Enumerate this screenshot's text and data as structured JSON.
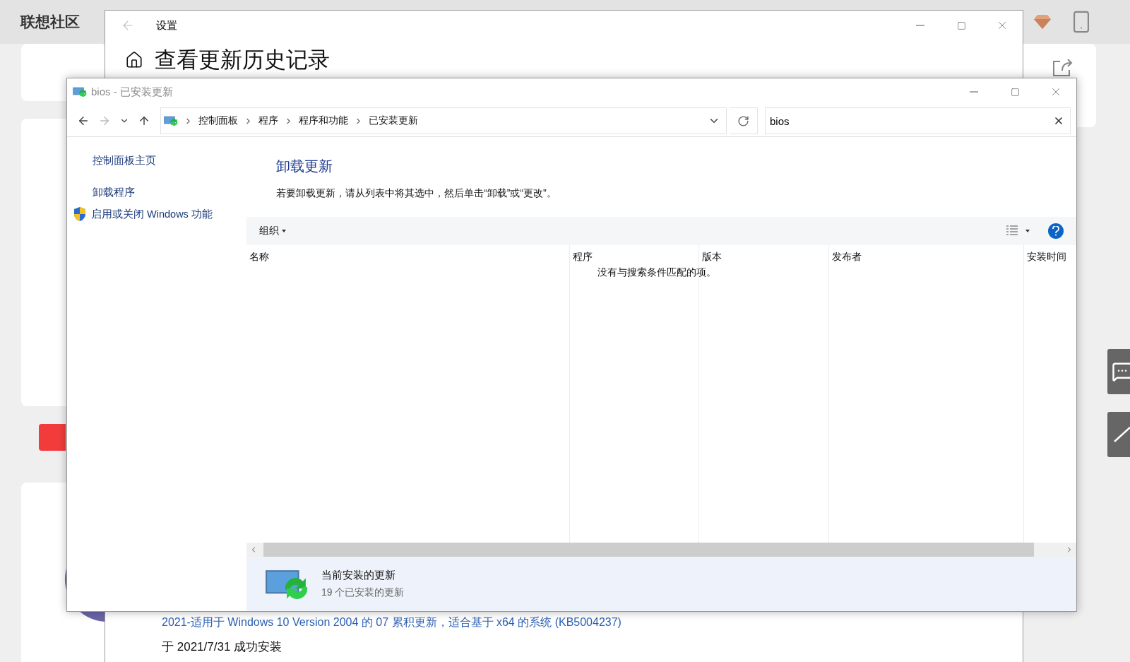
{
  "site": {
    "logo": "联想社区"
  },
  "settings_window": {
    "title": "设置",
    "heading": "查看更新历史记录",
    "update_link": "2021-适用于 Windows 10 Version 2004 的 07 累积更新，适合基于 x64 的系统 (KB5004237)",
    "update_status": "于 2021/7/31 成功安装"
  },
  "control_panel": {
    "title": "bios - 已安装更新",
    "breadcrumb": [
      "控制面板",
      "程序",
      "程序和功能",
      "已安装更新"
    ],
    "search": {
      "value": "bios"
    },
    "sidebar": {
      "items": [
        {
          "label": "控制面板主页",
          "kind": "link"
        },
        {
          "label": "卸载程序",
          "kind": "link"
        },
        {
          "label": "启用或关闭 Windows 功能",
          "kind": "shield"
        }
      ]
    },
    "heading": "卸载更新",
    "description": "若要卸载更新，请从列表中将其选中，然后单击“卸载”或“更改”。",
    "toolbar": {
      "organize": "组织"
    },
    "table": {
      "columns": [
        "名称",
        "程序",
        "版本",
        "发布者",
        "安装时间"
      ],
      "empty_message": "没有与搜索条件匹配的项。"
    },
    "details": {
      "title": "当前安装的更新",
      "subtitle": "19 个已安装的更新"
    }
  }
}
